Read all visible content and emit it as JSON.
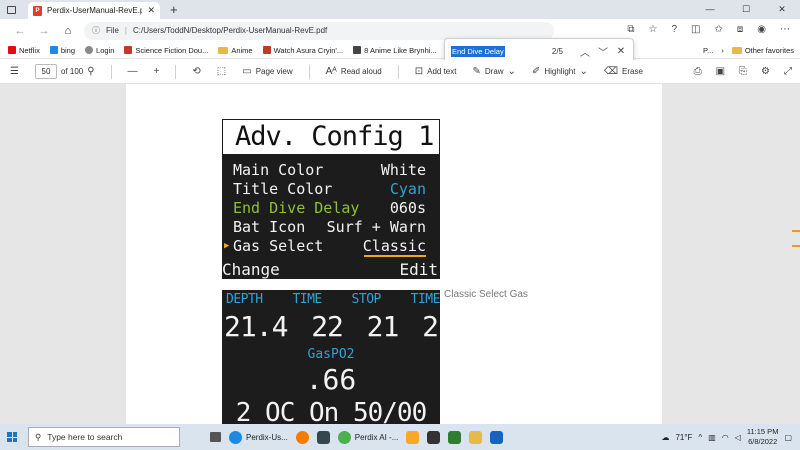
{
  "browser": {
    "tab_title": "Perdix-UserManual-RevE.pdf",
    "address_scheme": "File",
    "address_url": "C:/Users/ToddN/Desktop/Perdix-UserManual-RevE.pdf",
    "new_tab_glyph": "+",
    "win_minimize": "—",
    "win_maximize": "☐",
    "win_close": "✕"
  },
  "bookmarks": {
    "items": [
      {
        "label": "Netflix",
        "color": "#e50914"
      },
      {
        "label": "bing",
        "color": "#1e88e5"
      },
      {
        "label": "Login",
        "color": "#888888"
      },
      {
        "label": "Science Fiction Dou...",
        "color": "#c0392b"
      },
      {
        "label": "Anime",
        "color": "#e8b949"
      },
      {
        "label": "Watch Asura Cryin'...",
        "color": "#c0392b"
      },
      {
        "label": "8 Anime Like Brynhi...",
        "color": "#444444"
      }
    ],
    "more_label": "P...",
    "other_favorites": "Other favorites"
  },
  "find": {
    "query": "End Dive Delay",
    "count": "2/5"
  },
  "pdf_toolbar": {
    "page_number": "50",
    "page_total": "of 100",
    "page_view": "Page view",
    "read_aloud": "Read aloud",
    "add_text": "Add text",
    "draw": "Draw",
    "highlight": "Highlight",
    "erase": "Erase"
  },
  "document": {
    "screen1": {
      "title": "Adv. Config 1",
      "rows": [
        {
          "label": "Main Color",
          "value": "White",
          "label_color": "#f2f2f2",
          "value_color": "#f2f2f2"
        },
        {
          "label": "Title Color",
          "value": "Cyan",
          "label_color": "#f2f2f2",
          "value_color": "#2fa3d8"
        },
        {
          "label": "End Dive Delay",
          "value": "060s",
          "label_color": "#8fbf3a",
          "value_color": "#f2f2f2"
        },
        {
          "label": "Bat Icon",
          "value": "Surf + Warn",
          "label_color": "#f2f2f2",
          "value_color": "#f2f2f2"
        },
        {
          "label": "Gas Select",
          "value": "Classic",
          "label_color": "#f2f2f2",
          "value_color": "#f2f2f2"
        }
      ],
      "footer_left": "Change",
      "footer_right": "Edit"
    },
    "screen2": {
      "headers": [
        "DEPTH",
        "TIME",
        "STOP",
        "TIME"
      ],
      "values": [
        "21.4",
        "22",
        "21",
        "2"
      ],
      "gas_label": "GasPO2",
      "gas_value": ".66",
      "bottom": "2 OC On  50/00"
    },
    "caption": "Classic Select Gas"
  },
  "taskbar": {
    "search_placeholder": "Type here to search",
    "apps": [
      {
        "label": "Perdix-Us...",
        "color": "#1e88e5"
      },
      {
        "label": "",
        "color": "#f57c00"
      },
      {
        "label": "",
        "color": "#37474f"
      },
      {
        "label": "Perdix AI -...",
        "color": "#4caf50"
      },
      {
        "label": "",
        "color": "#f9a825"
      },
      {
        "label": "",
        "color": "#333333"
      },
      {
        "label": "",
        "color": "#2e7d32"
      },
      {
        "label": "",
        "color": "#1565c0"
      }
    ],
    "weather": "71°F",
    "time": "11:15 PM",
    "date": "6/8/2022"
  }
}
